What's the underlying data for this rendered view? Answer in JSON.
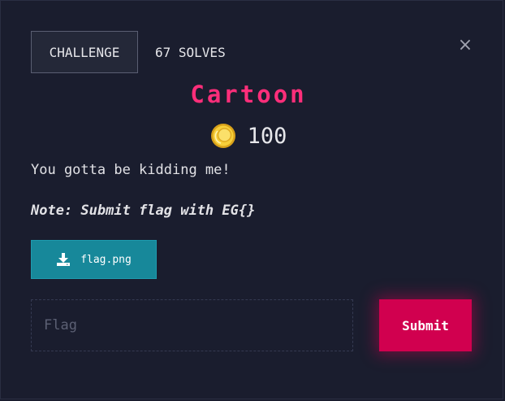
{
  "header": {
    "tab_challenge_label": "CHALLENGE",
    "tab_solves_label": "67 SOLVES",
    "close_label": "×"
  },
  "challenge": {
    "title": "Cartoon",
    "points": "100",
    "description": "You gotta be kidding me!",
    "note": "Note: Submit flag with EG{}",
    "file_name": "flag.png"
  },
  "form": {
    "flag_placeholder": "Flag",
    "flag_value": "",
    "submit_label": "Submit"
  },
  "icons": {
    "coin": "coin-icon",
    "download": "download-icon",
    "close": "close-icon"
  },
  "colors": {
    "background": "#1a1d2e",
    "title": "#ff2e7a",
    "file_button": "#17889a",
    "submit_button": "#d1004f",
    "coin": "#f2c230"
  }
}
